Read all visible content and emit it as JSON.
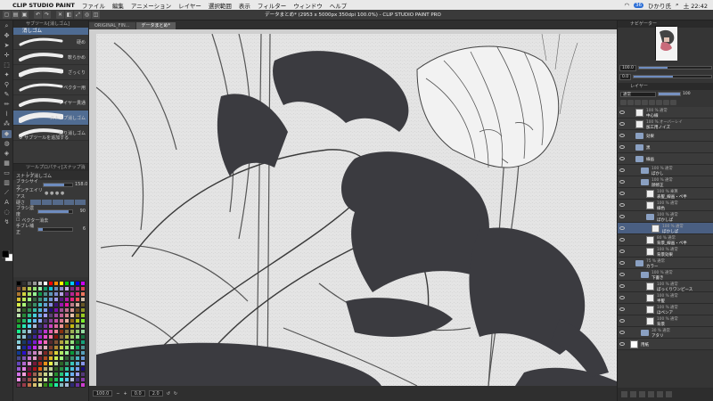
{
  "menubar": {
    "app_name": "CLIP STUDIO PAINT",
    "items": [
      "ファイル",
      "編集",
      "アニメーション",
      "レイヤー",
      "選択範囲",
      "表示",
      "フィルター",
      "ウィンドウ",
      "ヘルプ"
    ],
    "battery": "36",
    "user": "ひかり氏",
    "time": "土 22:42"
  },
  "document": {
    "title": "データまとめ* (2953 x 5000px 350dpi 100.0%)  - CLIP STUDIO PAINT PRO",
    "tabs": [
      "ORIGINAL_FIN...",
      "データまとめ*"
    ]
  },
  "subtool": {
    "panel_title": "サブツール[消しゴム]",
    "group_tab": "消しゴム",
    "brushes": [
      {
        "label": "硬め"
      },
      {
        "label": "軟らかめ"
      },
      {
        "label": "ざっくり"
      },
      {
        "label": "ベクター用"
      },
      {
        "label": "レイヤー貫通"
      },
      {
        "label": "スナップ消しゴム"
      },
      {
        "label": "練り消しゴム"
      }
    ],
    "selected_index": 5,
    "add_label": "サブツールを追加する"
  },
  "tool_property": {
    "title": "ツールプロパティ[スナップ消し]",
    "name": "スナップ消しゴム",
    "brush_size_label": "ブラシサイズ",
    "brush_size_value": "158.0",
    "brush_size_fraction": 0.72,
    "antialias_label": "アンチエイリアス",
    "hardness_label": "硬さ",
    "density_label": "ブラシ濃度",
    "density_value": "90",
    "density_fraction": 0.9,
    "vector_label": "ベクター消去",
    "stabilization_label": "手ブレ補正",
    "stabilization_value": "6"
  },
  "status": {
    "zoom": "100.0",
    "angle": "0.0",
    "position": "2.0"
  },
  "navigator": {
    "title": "ナビゲーター",
    "zoom": "100.0",
    "rotation": "0.0"
  },
  "layer_panel": {
    "title": "レイヤー",
    "blend_mode": "通常",
    "opacity": "100",
    "opacity_fraction": 1.0,
    "layers": [
      {
        "pct": "100 % 通常",
        "name": "中心線",
        "indent": 1,
        "type": "raster"
      },
      {
        "pct": "100 % オーバーレイ",
        "name": "加工用ノイズ",
        "indent": 1,
        "type": "raster"
      },
      {
        "pct": "",
        "name": "効果",
        "indent": 1,
        "type": "folder"
      },
      {
        "pct": "",
        "name": "黒",
        "indent": 1,
        "type": "folder"
      },
      {
        "pct": "",
        "name": "線画",
        "indent": 1,
        "type": "folder"
      },
      {
        "pct": "100 % 通常",
        "name": "ぼかし",
        "indent": 2,
        "type": "folder"
      },
      {
        "pct": "100 % 通常",
        "name": "顔修正",
        "indent": 2,
        "type": "folder"
      },
      {
        "pct": "100 % 乗算",
        "name": "表髪_線画・ペ半",
        "indent": 3,
        "type": "raster"
      },
      {
        "pct": "100 % 通常",
        "name": "線色",
        "indent": 3,
        "type": "raster"
      },
      {
        "pct": "100 % 通常",
        "name": "ぼかしぱ",
        "indent": 3,
        "type": "folder"
      },
      {
        "pct": "100 % 通常",
        "name": "ぼかしぱ",
        "indent": 4,
        "type": "raster"
      },
      {
        "pct": "80 % 通常",
        "name": "背景_線画・ペ半",
        "indent": 3,
        "type": "raster"
      },
      {
        "pct": "100 % 通常",
        "name": "背景効果",
        "indent": 3,
        "type": "raster"
      },
      {
        "pct": "75 % 通常",
        "name": "カラー",
        "indent": 1,
        "type": "folder"
      },
      {
        "pct": "100 % 通常",
        "name": "下書き",
        "indent": 2,
        "type": "folder"
      },
      {
        "pct": "100 % 通常",
        "name": "ぼっくりワンピース",
        "indent": 3,
        "type": "raster"
      },
      {
        "pct": "100 % 通常",
        "name": "半髪",
        "indent": 3,
        "type": "raster"
      },
      {
        "pct": "100 % 通常",
        "name": "ほペンア",
        "indent": 3,
        "type": "raster"
      },
      {
        "pct": "100 % 通常",
        "name": "背景",
        "indent": 3,
        "type": "raster"
      },
      {
        "pct": "30 % 通常",
        "name": "アタリ",
        "indent": 2,
        "type": "folder"
      },
      {
        "pct": "",
        "name": "用紙",
        "indent": 0,
        "type": "paper"
      }
    ],
    "selected_index": 10
  },
  "colors": {
    "accent": "#4e6b92",
    "main_color": "#000000",
    "sub_color": "#ffffff"
  }
}
